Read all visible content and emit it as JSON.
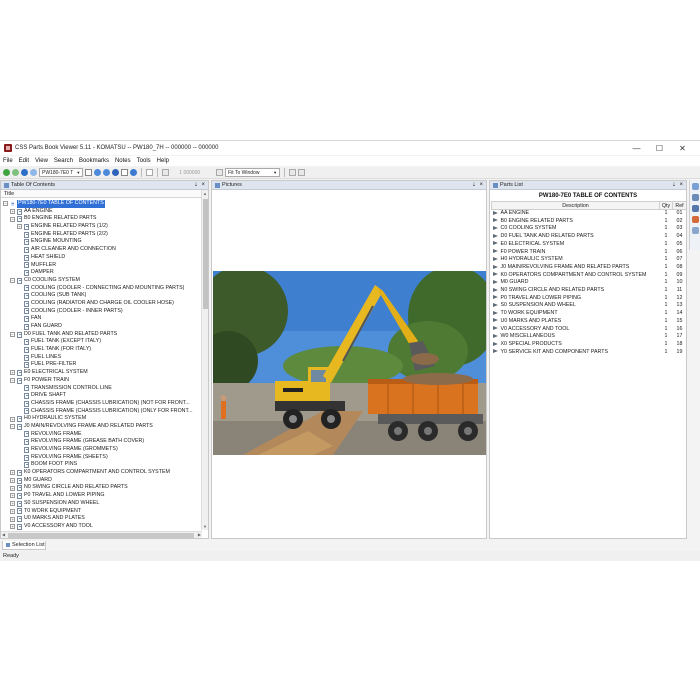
{
  "window": {
    "title": "CSS Parts Book Viewer 5.11 - KOMATSU -- PW180_7H -- 000000 -- 000000",
    "minimize": "—",
    "maximize": "☐",
    "close": "✕"
  },
  "menu": [
    "File",
    "Edit",
    "View",
    "Search",
    "Bookmarks",
    "Notes",
    "Tools",
    "Help"
  ],
  "toolbar": {
    "model_select": "PW180-7E0 T",
    "page_value": "1 000000",
    "zoom_select": "Fit To Window"
  },
  "toc": {
    "header": "Table Of Contents",
    "column": "Title",
    "rows": [
      {
        "indent": 0,
        "exp": "−",
        "label": "PW180-7E0 TABLE OF CONTENTS",
        "selected": true
      },
      {
        "indent": 1,
        "exp": "+",
        "label": "AA ENGINE"
      },
      {
        "indent": 1,
        "exp": "−",
        "label": "B0 ENGINE RELATED PARTS"
      },
      {
        "indent": 2,
        "exp": "+",
        "label": "ENGINE RELATED PARTS (1/2)"
      },
      {
        "indent": 2,
        "exp": "",
        "label": "ENGINE RELATED PARTS (2/2)"
      },
      {
        "indent": 2,
        "exp": "",
        "label": "ENGINE MOUNTING"
      },
      {
        "indent": 2,
        "exp": "",
        "label": "AIR CLEANER AND CONNECTION"
      },
      {
        "indent": 2,
        "exp": "",
        "label": "HEAT SHIELD"
      },
      {
        "indent": 2,
        "exp": "",
        "label": "MUFFLER"
      },
      {
        "indent": 2,
        "exp": "",
        "label": "DAMPER"
      },
      {
        "indent": 1,
        "exp": "−",
        "label": "C0 COOLING SYSTEM"
      },
      {
        "indent": 2,
        "exp": "",
        "label": "COOLING (COOLER - CONNECTING AND MOUNTING PARTS)"
      },
      {
        "indent": 2,
        "exp": "",
        "label": "COOLING (SUB TANK)"
      },
      {
        "indent": 2,
        "exp": "",
        "label": "COOLING (RADIATOR AND CHARGE OIL COOLER HOSE)"
      },
      {
        "indent": 2,
        "exp": "",
        "label": "COOLING (COOLER - INNER PARTS)"
      },
      {
        "indent": 2,
        "exp": "",
        "label": "FAN"
      },
      {
        "indent": 2,
        "exp": "",
        "label": "FAN GUARD"
      },
      {
        "indent": 1,
        "exp": "−",
        "label": "D0 FUEL TANK AND RELATED PARTS"
      },
      {
        "indent": 2,
        "exp": "",
        "label": "FUEL TANK (EXCEPT ITALY)"
      },
      {
        "indent": 2,
        "exp": "",
        "label": "FUEL TANK (FOR ITALY)"
      },
      {
        "indent": 2,
        "exp": "",
        "label": "FUEL LINES"
      },
      {
        "indent": 2,
        "exp": "",
        "label": "FUEL PRE-FILTER"
      },
      {
        "indent": 1,
        "exp": "+",
        "label": "E0 ELECTRICAL SYSTEM"
      },
      {
        "indent": 1,
        "exp": "−",
        "label": "F0 POWER TRAIN"
      },
      {
        "indent": 2,
        "exp": "",
        "label": "TRANSMISSION CONTROL LINE"
      },
      {
        "indent": 2,
        "exp": "",
        "label": "DRIVE SHAFT"
      },
      {
        "indent": 2,
        "exp": "",
        "label": "CHASSIS FRAME (CHASSIS LUBRICATION) (NOT FOR FRONT..."
      },
      {
        "indent": 2,
        "exp": "",
        "label": "CHASSIS FRAME (CHASSIS LUBRICATION) (ONLY FOR FRONT..."
      },
      {
        "indent": 1,
        "exp": "+",
        "label": "H0 HYDRAULIC SYSTEM"
      },
      {
        "indent": 1,
        "exp": "−",
        "label": "J0 MAIN/REVOLVING FRAME AND RELATED PARTS"
      },
      {
        "indent": 2,
        "exp": "",
        "label": "REVOLVING FRAME"
      },
      {
        "indent": 2,
        "exp": "",
        "label": "REVOLVING FRAME (GREASE BATH COVER)"
      },
      {
        "indent": 2,
        "exp": "",
        "label": "REVOLVING FRAME (GROMMETS)"
      },
      {
        "indent": 2,
        "exp": "",
        "label": "REVOLVING FRAME (SHEETS)"
      },
      {
        "indent": 2,
        "exp": "",
        "label": "BOOM FOOT PINS"
      },
      {
        "indent": 1,
        "exp": "+",
        "label": "K0 OPERATORS COMPARTMENT AND CONTROL SYSTEM"
      },
      {
        "indent": 1,
        "exp": "+",
        "label": "M0 GUARD"
      },
      {
        "indent": 1,
        "exp": "+",
        "label": "N0 SWING CIRCLE AND RELATED PARTS"
      },
      {
        "indent": 1,
        "exp": "+",
        "label": "P0 TRAVEL AND LOWER PIPING"
      },
      {
        "indent": 1,
        "exp": "+",
        "label": "S0 SUSPENSION AND WHEEL"
      },
      {
        "indent": 1,
        "exp": "+",
        "label": "T0 WORK EQUIPMENT"
      },
      {
        "indent": 1,
        "exp": "+",
        "label": "U0 MARKS AND PLATES"
      },
      {
        "indent": 1,
        "exp": "+",
        "label": "V0 ACCESSORY AND TOOL"
      }
    ]
  },
  "pictures": {
    "header": "Pictures"
  },
  "parts": {
    "header": "Parts List",
    "title": "PW180-7E0 TABLE OF CONTENTS",
    "columns": {
      "desc": "Description",
      "qty": "Qty",
      "ref": "Ref"
    },
    "rows": [
      {
        "desc": "AA ENGINE",
        "qty": "1",
        "ref": "01"
      },
      {
        "desc": "B0 ENGINE RELATED PARTS",
        "qty": "1",
        "ref": "02"
      },
      {
        "desc": "C0 COOLING SYSTEM",
        "qty": "1",
        "ref": "03"
      },
      {
        "desc": "D0 FUEL TANK AND RELATED PARTS",
        "qty": "1",
        "ref": "04"
      },
      {
        "desc": "E0 ELECTRICAL SYSTEM",
        "qty": "1",
        "ref": "05"
      },
      {
        "desc": "F0 POWER TRAIN",
        "qty": "1",
        "ref": "06"
      },
      {
        "desc": "H0 HYDRAULIC SYSTEM",
        "qty": "1",
        "ref": "07"
      },
      {
        "desc": "J0 MAIN/REVOLVING FRAME AND RELATED PARTS",
        "qty": "1",
        "ref": "08"
      },
      {
        "desc": "K0 OPERATORS COMPARTMENT AND CONTROL SYSTEM",
        "qty": "1",
        "ref": "09"
      },
      {
        "desc": "M0 GUARD",
        "qty": "1",
        "ref": "10"
      },
      {
        "desc": "N0 SWING CIRCLE AND RELATED PARTS",
        "qty": "1",
        "ref": "11"
      },
      {
        "desc": "P0 TRAVEL AND LOWER PIPING",
        "qty": "1",
        "ref": "12"
      },
      {
        "desc": "S0 SUSPENSION AND WHEEL",
        "qty": "1",
        "ref": "13"
      },
      {
        "desc": "T0 WORK EQUIPMENT",
        "qty": "1",
        "ref": "14"
      },
      {
        "desc": "U0 MARKS AND PLATES",
        "qty": "1",
        "ref": "15"
      },
      {
        "desc": "V0 ACCESSORY AND TOOL",
        "qty": "1",
        "ref": "16"
      },
      {
        "desc": "W0 MISCELLANEOUS",
        "qty": "1",
        "ref": "17"
      },
      {
        "desc": "X0 SPECIAL PRODUCTS",
        "qty": "1",
        "ref": "18"
      },
      {
        "desc": "Y0 SERVICE KIT AND COMPONENT PARTS",
        "qty": "1",
        "ref": "19"
      }
    ]
  },
  "bottom_tab": "Selection List",
  "status": "Ready",
  "colors": {
    "selection": "#2f6fd6",
    "pane_header": "#dfe5ee",
    "excavator_yellow": "#e8b820",
    "truck_orange": "#d9731f"
  }
}
